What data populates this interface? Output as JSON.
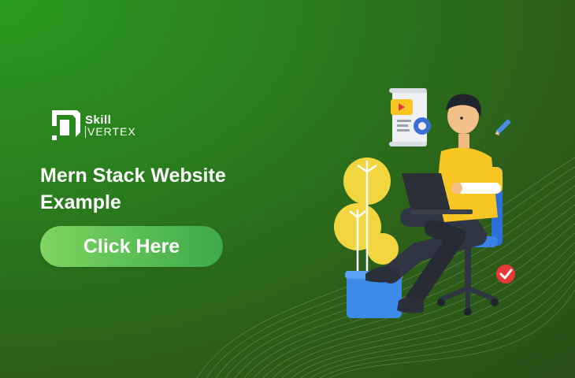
{
  "brand": {
    "name_top": "Skill",
    "name_bottom": "VERTEX",
    "logo_icon": "skillvertex-logo-icon"
  },
  "headline": {
    "line1": "Mern Stack Website",
    "line2": "Example"
  },
  "cta": {
    "label": "Click Here"
  },
  "colors": {
    "background_start": "#2a9a1f",
    "background_end": "#2a4f17",
    "cta_start": "#7fd461",
    "cta_end": "#3fa84a",
    "accent_yellow": "#f7c623",
    "text": "#ffffff"
  },
  "illustration": {
    "subject": "person-with-laptop-on-chair-icon",
    "extras": [
      "document-with-play-and-gear-icon",
      "pencil-icon",
      "check-badge-icon",
      "potted-plant-icon"
    ]
  }
}
